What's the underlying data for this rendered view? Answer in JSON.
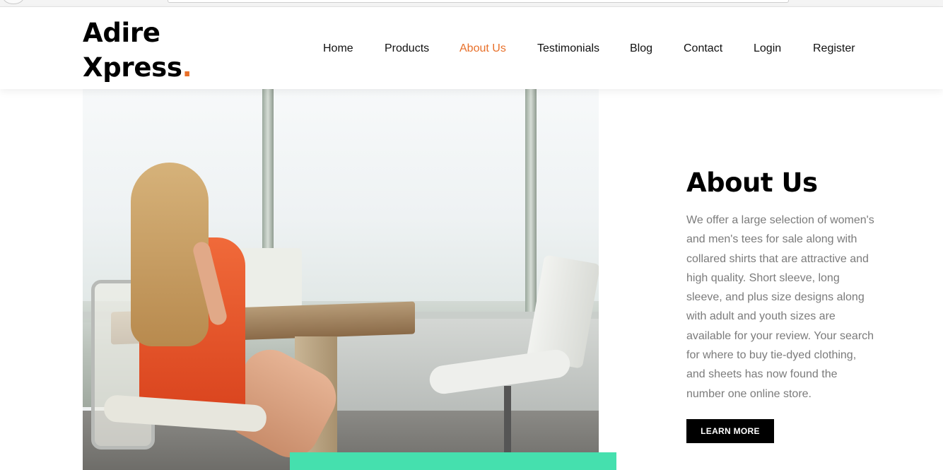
{
  "brand": {
    "line1": "Adire",
    "line2": "Xpress",
    "dot": ".",
    "accent_color": "#e8702a"
  },
  "nav": {
    "items": [
      {
        "label": "Home"
      },
      {
        "label": "Products"
      },
      {
        "label": "About Us",
        "active": true
      },
      {
        "label": "Testimonials"
      },
      {
        "label": "Blog"
      },
      {
        "label": "Contact"
      },
      {
        "label": "Login"
      },
      {
        "label": "Register"
      }
    ]
  },
  "about": {
    "title": "About Us",
    "body": "We offer a large selection of women's and men's tees for sale along with collared shirts that are attractive and high quality. Short sleeve, long sleeve, and plus size designs along with adult and youth sizes are available for your review. Your search for where to buy tie-dyed clothing, and sheets has now found the number one online store.",
    "button_label": "LEARN MORE"
  },
  "colors": {
    "accent": "#e8702a",
    "highlight_bar": "#45e0ae",
    "button_bg": "#000000",
    "body_text": "#7b7b7b"
  }
}
